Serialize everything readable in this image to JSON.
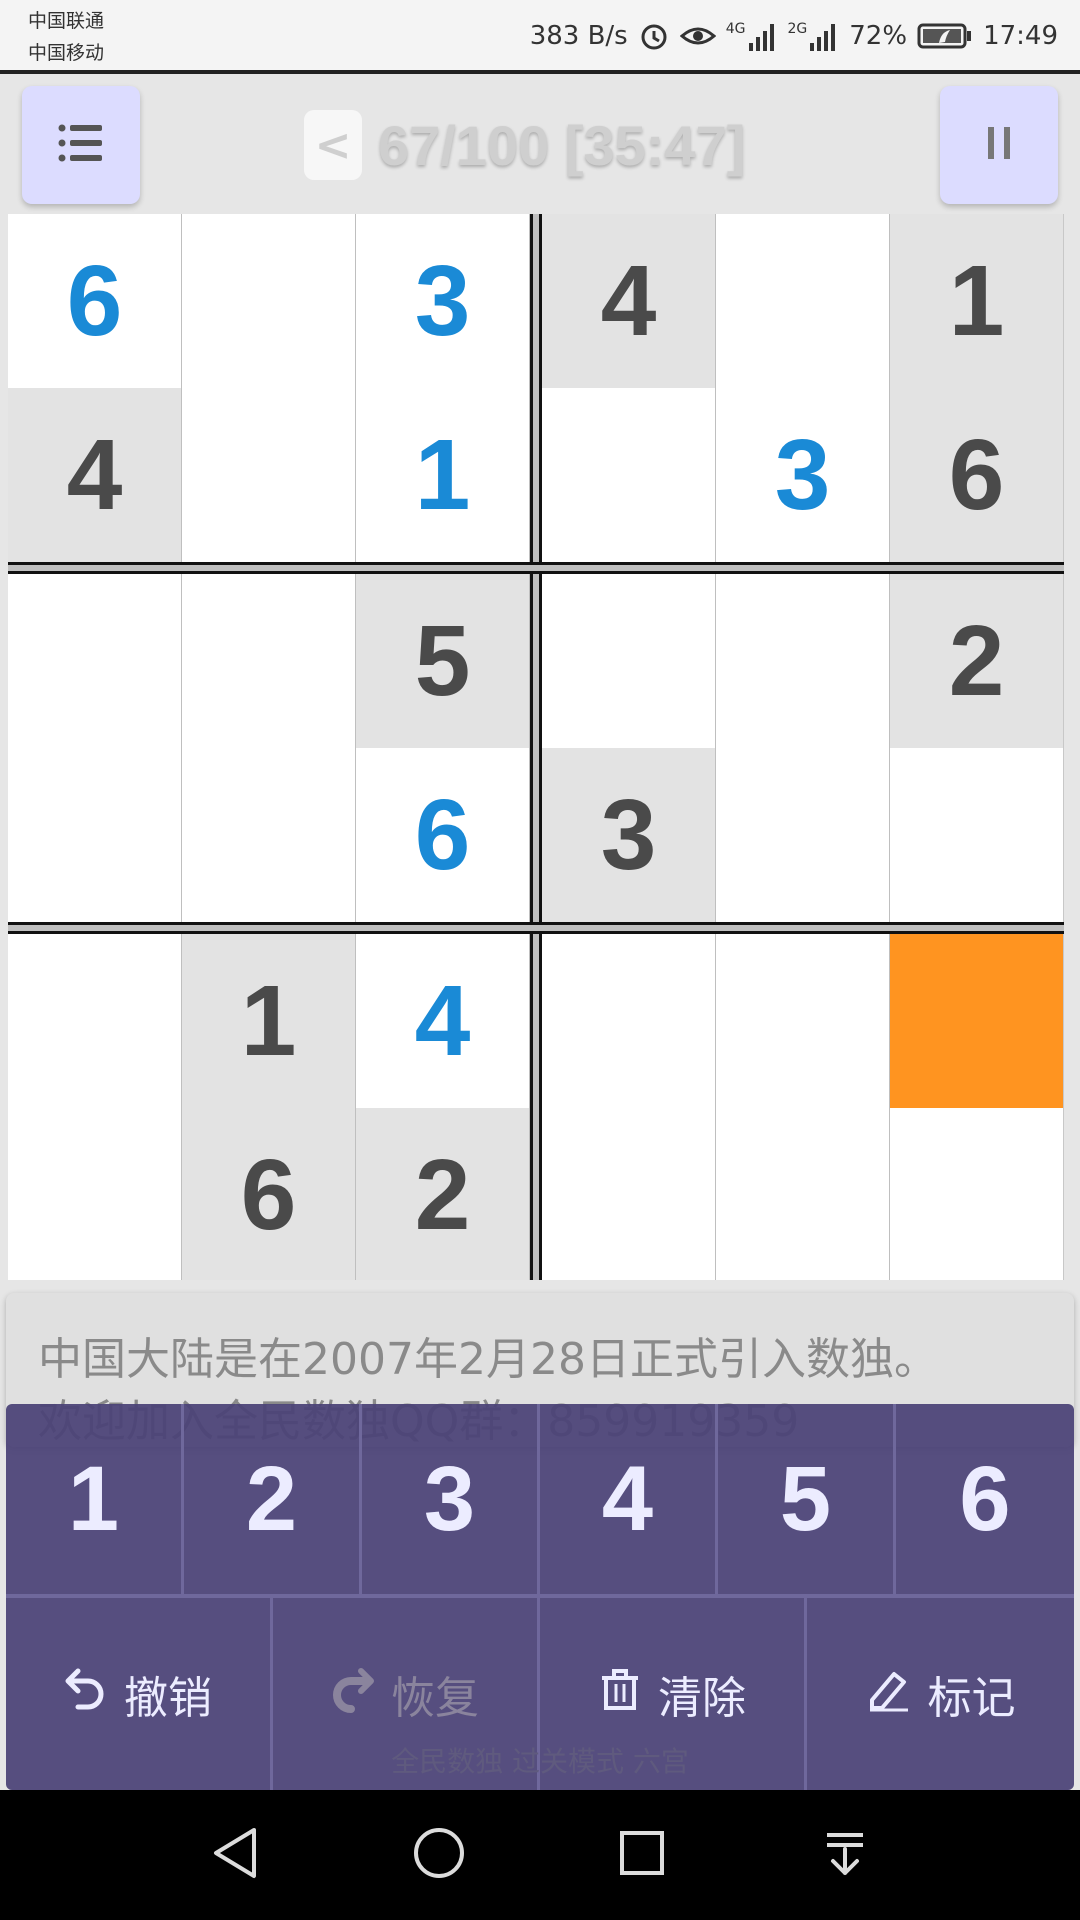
{
  "status_bar": {
    "carrier_1": "中国联通",
    "carrier_2": "中国移动",
    "net_speed": "383 B/s",
    "signal_1": "4G",
    "signal_2": "2G",
    "battery": "72%",
    "time": "17:49"
  },
  "header": {
    "back_label": "<",
    "title": "67/100 [35:47]"
  },
  "board": {
    "size": 6,
    "selected": [
      4,
      5
    ],
    "given_colors": {
      "given_bg": "#e3e3e3",
      "user_digit": "#1a8ad6",
      "selected_bg": "#ff9420"
    },
    "cells": [
      [
        {
          "v": "6",
          "t": "user"
        },
        {
          "v": "",
          "t": "empty"
        },
        {
          "v": "3",
          "t": "user"
        },
        {
          "v": "4",
          "t": "given"
        },
        {
          "v": "",
          "t": "empty"
        },
        {
          "v": "1",
          "t": "given"
        }
      ],
      [
        {
          "v": "4",
          "t": "given"
        },
        {
          "v": "",
          "t": "empty"
        },
        {
          "v": "1",
          "t": "user"
        },
        {
          "v": "",
          "t": "empty"
        },
        {
          "v": "3",
          "t": "user"
        },
        {
          "v": "6",
          "t": "given"
        }
      ],
      [
        {
          "v": "",
          "t": "empty"
        },
        {
          "v": "",
          "t": "empty"
        },
        {
          "v": "5",
          "t": "given"
        },
        {
          "v": "",
          "t": "empty"
        },
        {
          "v": "",
          "t": "empty"
        },
        {
          "v": "2",
          "t": "given"
        }
      ],
      [
        {
          "v": "",
          "t": "empty"
        },
        {
          "v": "",
          "t": "empty"
        },
        {
          "v": "6",
          "t": "user"
        },
        {
          "v": "3",
          "t": "given"
        },
        {
          "v": "",
          "t": "empty"
        },
        {
          "v": "",
          "t": "empty"
        }
      ],
      [
        {
          "v": "",
          "t": "empty"
        },
        {
          "v": "1",
          "t": "given"
        },
        {
          "v": "4",
          "t": "user"
        },
        {
          "v": "",
          "t": "empty"
        },
        {
          "v": "",
          "t": "empty"
        },
        {
          "v": "",
          "t": "selected"
        }
      ],
      [
        {
          "v": "",
          "t": "empty"
        },
        {
          "v": "6",
          "t": "given"
        },
        {
          "v": "2",
          "t": "given"
        },
        {
          "v": "",
          "t": "empty"
        },
        {
          "v": "",
          "t": "empty"
        },
        {
          "v": "",
          "t": "empty"
        }
      ]
    ]
  },
  "hint": {
    "line_1": "中国大陆是在2007年2月28日正式引入数独。",
    "line_2": "欢迎加入全民数独QQ群：859919359"
  },
  "keypad": {
    "numbers": [
      "1",
      "2",
      "3",
      "4",
      "5",
      "6"
    ],
    "undo_label": "撤销",
    "redo_label": "恢复",
    "clear_label": "清除",
    "mark_label": "标记"
  },
  "footer": {
    "label": "全民数独 过关模式 六宫"
  }
}
